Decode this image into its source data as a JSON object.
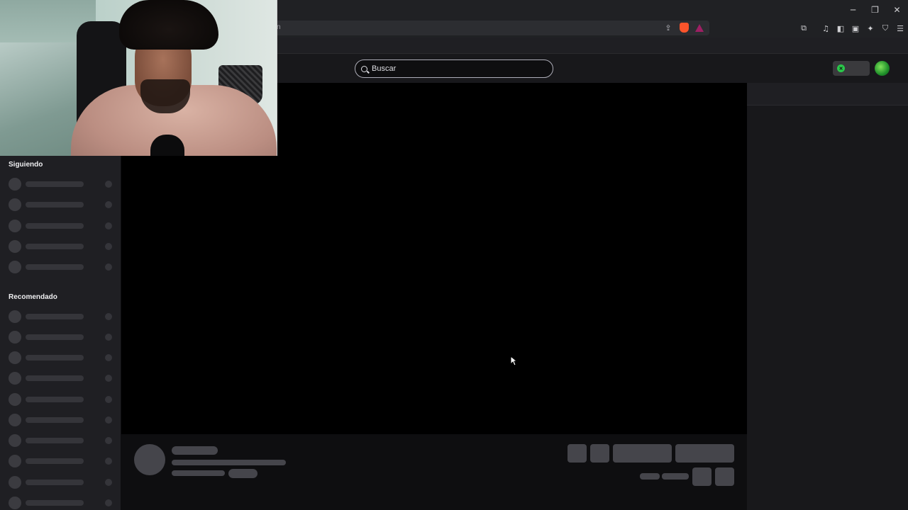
{
  "browser": {
    "url_fragment": "n",
    "window_controls": [
      "─",
      "❐",
      "✕"
    ]
  },
  "header": {
    "search": {
      "placeholder": "Buscar"
    }
  },
  "sidebar": {
    "following_title": "Siguiendo",
    "following_placeholder_count": 5,
    "recommended_title": "Recomendado",
    "recommended_placeholder_count": 10
  }
}
